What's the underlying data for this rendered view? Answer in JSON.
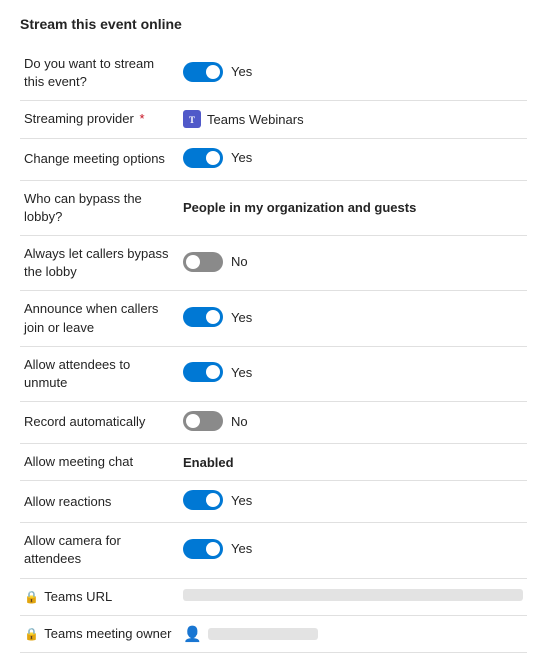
{
  "title": "Stream this event online",
  "rows": [
    {
      "id": "stream-event",
      "label": "Do you want to stream this event?",
      "type": "toggle",
      "state": "on",
      "value_label": "Yes",
      "required": false,
      "locked": false
    },
    {
      "id": "streaming-provider",
      "label": "Streaming provider",
      "type": "provider",
      "value_label": "Teams Webinars",
      "required": true,
      "locked": false
    },
    {
      "id": "change-meeting-options",
      "label": "Change meeting options",
      "type": "toggle",
      "state": "on",
      "value_label": "Yes",
      "required": false,
      "locked": false
    },
    {
      "id": "bypass-lobby",
      "label": "Who can bypass the lobby?",
      "type": "bold-text",
      "value_label": "People in my organization and guests",
      "required": false,
      "locked": false
    },
    {
      "id": "callers-bypass-lobby",
      "label": "Always let callers bypass the lobby",
      "type": "toggle",
      "state": "off",
      "value_label": "No",
      "required": false,
      "locked": false
    },
    {
      "id": "announce-join-leave",
      "label": "Announce when callers join or leave",
      "type": "toggle",
      "state": "on",
      "value_label": "Yes",
      "required": false,
      "locked": false
    },
    {
      "id": "allow-unmute",
      "label": "Allow attendees to unmute",
      "type": "toggle",
      "state": "on",
      "value_label": "Yes",
      "required": false,
      "locked": false
    },
    {
      "id": "record-automatically",
      "label": "Record automatically",
      "type": "toggle",
      "state": "off",
      "value_label": "No",
      "required": false,
      "locked": false
    },
    {
      "id": "allow-meeting-chat",
      "label": "Allow meeting chat",
      "type": "bold-text",
      "value_label": "Enabled",
      "required": false,
      "locked": false
    },
    {
      "id": "allow-reactions",
      "label": "Allow reactions",
      "type": "toggle",
      "state": "on",
      "value_label": "Yes",
      "required": false,
      "locked": false
    },
    {
      "id": "allow-camera",
      "label": "Allow camera for attendees",
      "type": "toggle",
      "state": "on",
      "value_label": "Yes",
      "required": false,
      "locked": false
    },
    {
      "id": "teams-url",
      "label": "Teams URL",
      "type": "url",
      "locked": true
    },
    {
      "id": "teams-meeting-owner",
      "label": "Teams meeting owner",
      "type": "owner",
      "locked": true
    }
  ]
}
